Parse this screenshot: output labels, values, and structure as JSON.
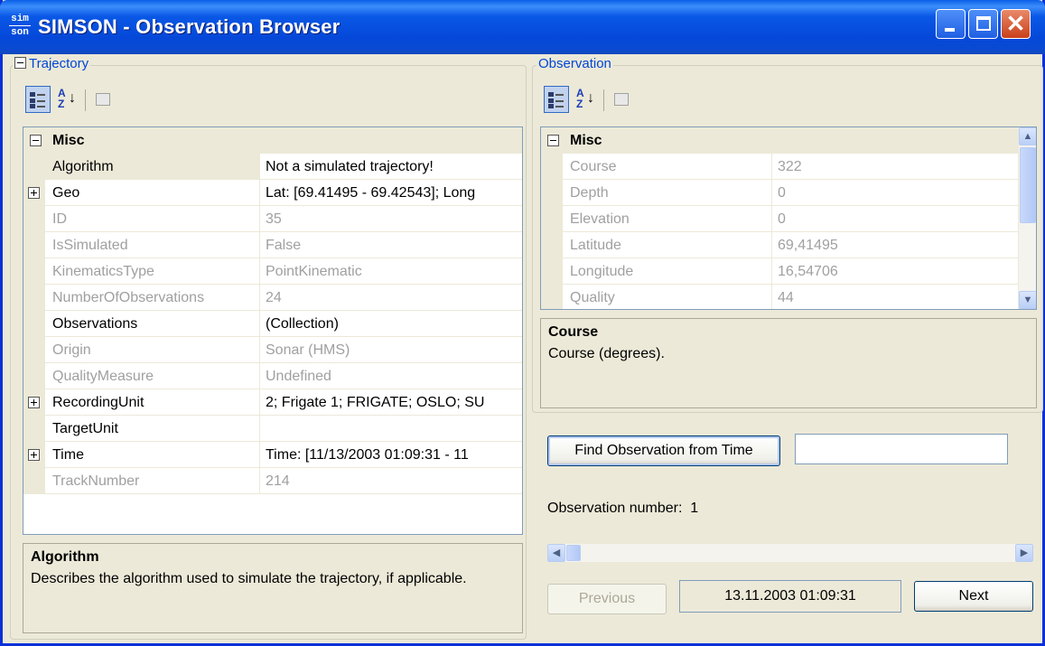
{
  "window": {
    "title": "SIMSON - Observation Browser",
    "icon_top": "sim",
    "icon_bottom": "son"
  },
  "trajectory": {
    "group_title": "Trajectory",
    "category": "Misc",
    "rows": [
      {
        "name": "Algorithm",
        "value": "Not a simulated trajectory!",
        "readonly": false,
        "expandable": false,
        "selected": true
      },
      {
        "name": "Geo",
        "value": "Lat: [69.41495 - 69.42543]; Long",
        "readonly": false,
        "expandable": true
      },
      {
        "name": "ID",
        "value": "35",
        "readonly": true,
        "expandable": false
      },
      {
        "name": "IsSimulated",
        "value": "False",
        "readonly": true,
        "expandable": false
      },
      {
        "name": "KinematicsType",
        "value": "PointKinematic",
        "readonly": true,
        "expandable": false
      },
      {
        "name": "NumberOfObservations",
        "value": "24",
        "readonly": true,
        "expandable": false
      },
      {
        "name": "Observations",
        "value": "(Collection)",
        "readonly": false,
        "expandable": false
      },
      {
        "name": "Origin",
        "value": "Sonar (HMS)",
        "readonly": true,
        "expandable": false
      },
      {
        "name": "QualityMeasure",
        "value": "Undefined",
        "readonly": true,
        "expandable": false
      },
      {
        "name": "RecordingUnit",
        "value": "2; Frigate 1; FRIGATE; OSLO; SU",
        "readonly": false,
        "expandable": true
      },
      {
        "name": "TargetUnit",
        "value": "",
        "readonly": false,
        "expandable": false
      },
      {
        "name": "Time",
        "value": "Time: [11/13/2003 01:09:31 - 11",
        "readonly": false,
        "expandable": true
      },
      {
        "name": "TrackNumber",
        "value": "214",
        "readonly": true,
        "expandable": false
      }
    ],
    "description_title": "Algorithm",
    "description_text": "Describes the algorithm used to simulate the trajectory, if applicable."
  },
  "observation": {
    "group_title": "Observation",
    "category": "Misc",
    "rows": [
      {
        "name": "Course",
        "value": "322",
        "readonly": true
      },
      {
        "name": "Depth",
        "value": "0",
        "readonly": true
      },
      {
        "name": "Elevation",
        "value": "0",
        "readonly": true
      },
      {
        "name": "Latitude",
        "value": "69,41495",
        "readonly": true
      },
      {
        "name": "Longitude",
        "value": "16,54706",
        "readonly": true
      },
      {
        "name": "Quality",
        "value": "44",
        "readonly": true
      }
    ],
    "description_title": "Course",
    "description_text": "Course (degrees).",
    "find_button": "Find Observation from Time",
    "time_input_value": "",
    "number_label": "Observation number:",
    "number_value": "1",
    "previous_button": "Previous",
    "current_time": "13.11.2003 01:09:31",
    "next_button": "Next"
  },
  "icons": {
    "categorized": "categorized-view-icon",
    "alphabetical": "alphabetical-sort-icon",
    "property_pages": "property-pages-icon"
  }
}
